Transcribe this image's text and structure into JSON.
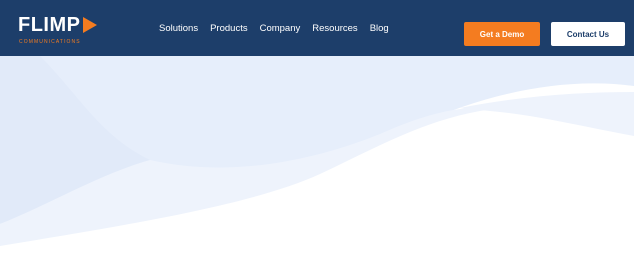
{
  "nav": {
    "logo_text": "FLIMP",
    "logo_subtext": "COMMUNICATIONS",
    "links": [
      {
        "label": "Solutions"
      },
      {
        "label": "Products"
      },
      {
        "label": "Company"
      },
      {
        "label": "Resources"
      },
      {
        "label": "Blog"
      }
    ],
    "demo_button": "Get a Demo",
    "contact_button": "Contact Us"
  },
  "colors": {
    "nav_background": "#1d3e6a",
    "accent": "#f47c20",
    "hero_wave_light": "#e8f0fc",
    "hero_wave_mid": "#dce7f8"
  },
  "icons": {
    "logo_arrow": "play-triangle-icon"
  }
}
